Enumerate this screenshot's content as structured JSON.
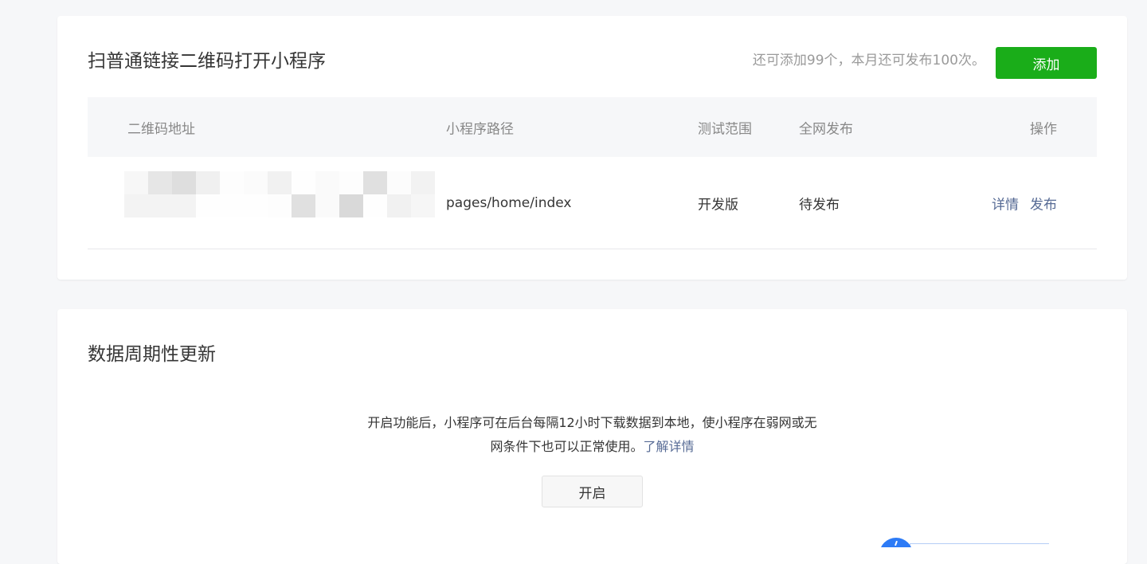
{
  "qrcode_section": {
    "title": "扫普通链接二维码打开小程序",
    "quota": "还可添加99个，本月还可发布100次。",
    "add_button": "添加",
    "columns": {
      "qr": "二维码地址",
      "path": "小程序路径",
      "range": "测试范围",
      "release": "全网发布",
      "op": "操作"
    },
    "rows": [
      {
        "path": "pages/home/index",
        "range": "开发版",
        "release": "待发布",
        "detail": "详情",
        "publish": "发布"
      }
    ]
  },
  "periodic_section": {
    "title": "数据周期性更新",
    "desc_line1": "开启功能后，小程序可在后台每隔12小时下载数据到本地，使小程序在弱网或无",
    "desc_line2": "网条件下也可以正常使用。",
    "learn_more": "了解详情",
    "enable_button": "开启"
  },
  "colors": {
    "primary": "#1aad19",
    "link": "#576b95",
    "background": "#f6f7f9"
  }
}
